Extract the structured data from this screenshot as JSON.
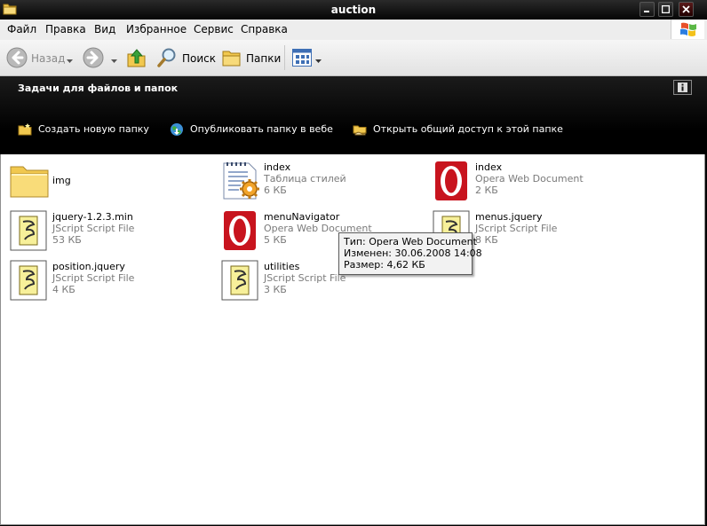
{
  "window": {
    "title": "auction"
  },
  "menu": {
    "items": [
      "Файл",
      "Правка",
      "Вид",
      "Избранное",
      "Сервис",
      "Справка"
    ]
  },
  "toolbar": {
    "back_label": "Назад",
    "search_label": "Поиск",
    "folders_label": "Папки"
  },
  "taskpane": {
    "title": "Задачи для файлов и папок",
    "links": [
      "Создать новую папку",
      "Опубликовать папку в вебе",
      "Открыть общий доступ к этой папке"
    ]
  },
  "files": [
    {
      "name": "img",
      "type": "",
      "size": "",
      "icon": "folder-icon"
    },
    {
      "name": "index",
      "type": "Таблица стилей",
      "size": "6 КБ",
      "icon": "stylesheet-icon"
    },
    {
      "name": "index",
      "type": "Opera Web Document",
      "size": "2 КБ",
      "icon": "opera-icon"
    },
    {
      "name": "jquery-1.2.3.min",
      "type": "JScript Script File",
      "size": "53 КБ",
      "icon": "script-icon"
    },
    {
      "name": "menuNavigator",
      "type": "Opera Web Document",
      "size": "5 КБ",
      "icon": "opera-icon"
    },
    {
      "name": "menus.jquery",
      "type": "JScript Script File",
      "size": "8 КБ",
      "icon": "script-icon"
    },
    {
      "name": "position.jquery",
      "type": "JScript Script File",
      "size": "4 КБ",
      "icon": "script-icon"
    },
    {
      "name": "utilities",
      "type": "JScript Script File",
      "size": "3 КБ",
      "icon": "script-icon"
    }
  ],
  "tooltip": {
    "type_line": "Тип: Opera Web Document",
    "modified_line": "Изменен: 30.06.2008 14:08",
    "size_line": "Размер: 4,62 КБ"
  },
  "colors": {
    "titlebar": "#0a0a0a",
    "taskpane": "#000000",
    "opera_red": "#c8141e",
    "folder_yellow": "#f5d06a"
  }
}
